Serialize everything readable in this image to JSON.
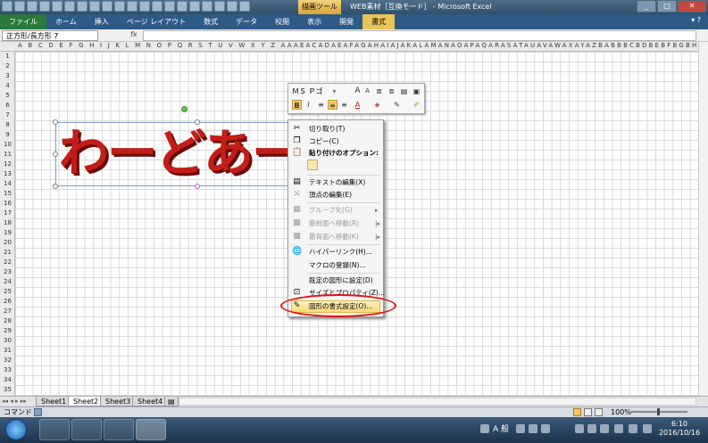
{
  "window": {
    "title": "WEB素材［互換モード］ - Microsoft Excel",
    "context_tool": "描画ツール",
    "buttons": {
      "minimize": "_",
      "restore": "□",
      "close": "✕"
    }
  },
  "ribbon": {
    "tabs": [
      "ファイル",
      "ホーム",
      "挿入",
      "ページ レイアウト",
      "数式",
      "データ",
      "校閲",
      "表示",
      "開発",
      "書式"
    ],
    "help": "▾ ?"
  },
  "formula_bar": {
    "name_box": "正方形/長方形 7",
    "fx": "fx",
    "value": ""
  },
  "columns": "A B C D E F G H I J K L M N O P Q R S T U V W X Y Z AAAEACADAEAFAGAHAIAJAKALAMANAOAPAQARASATAUAVAWAXAYAZBABBBCBDBEBFBGBHBIBJBKBLBMBNBOBPBQ",
  "rows": [
    "1",
    "2",
    "3",
    "4",
    "5",
    "6",
    "7",
    "8",
    "9",
    "10",
    "11",
    "12",
    "13",
    "14",
    "15",
    "16",
    "17",
    "18",
    "19",
    "20",
    "21",
    "22",
    "23",
    "24",
    "25",
    "26",
    "27",
    "28",
    "29",
    "30",
    "31",
    "32",
    "33",
    "34",
    "35"
  ],
  "shape": {
    "text": "わーどあーと"
  },
  "mini_toolbar": {
    "font": "ＭＳ Ｐゴ",
    "buttons": [
      "A",
      "A",
      "B",
      "I"
    ]
  },
  "context_menu": {
    "items": [
      {
        "label": "切り取り(T)",
        "icon": "scissors-icon",
        "disabled": false
      },
      {
        "label": "コピー(C)",
        "icon": "copy-icon",
        "disabled": false
      },
      {
        "label": "貼り付けのオプション:",
        "icon": "paste-icon",
        "disabled": false
      },
      {
        "label": "テキストの編集(X)",
        "icon": "text-edit-icon",
        "disabled": false
      },
      {
        "label": "頂点の編集(E)",
        "icon": "vertex-edit-icon",
        "disabled": false
      },
      {
        "label": "グループ化(G)",
        "icon": "group-icon",
        "disabled": true
      },
      {
        "label": "最前面へ移動(R)",
        "icon": "bring-front-icon",
        "disabled": true
      },
      {
        "label": "最背面へ移動(K)",
        "icon": "send-back-icon",
        "disabled": true
      },
      {
        "label": "ハイパーリンク(H)...",
        "icon": "hyperlink-icon",
        "disabled": false
      },
      {
        "label": "マクロの登録(N)...",
        "icon": "",
        "disabled": false
      },
      {
        "label": "既定の図形に設定(D)",
        "icon": "",
        "disabled": false
      },
      {
        "label": "サイズとプロパティ(Z)...",
        "icon": "size-icon",
        "disabled": false
      },
      {
        "label": "図形の書式設定(O)...",
        "icon": "format-shape-icon",
        "disabled": false
      }
    ]
  },
  "sheets": [
    "Sheet1",
    "Sheet2",
    "Sheet3",
    "Sheet4"
  ],
  "active_sheet": "Sheet2",
  "status": {
    "mode": "コマンド",
    "zoom": "100%"
  },
  "taskbar": {
    "ime": "A 般",
    "time": "6:10",
    "date": "2016/10/16"
  },
  "colors": {
    "wordart": "#c21d18",
    "highlight_ring": "#e01414"
  }
}
